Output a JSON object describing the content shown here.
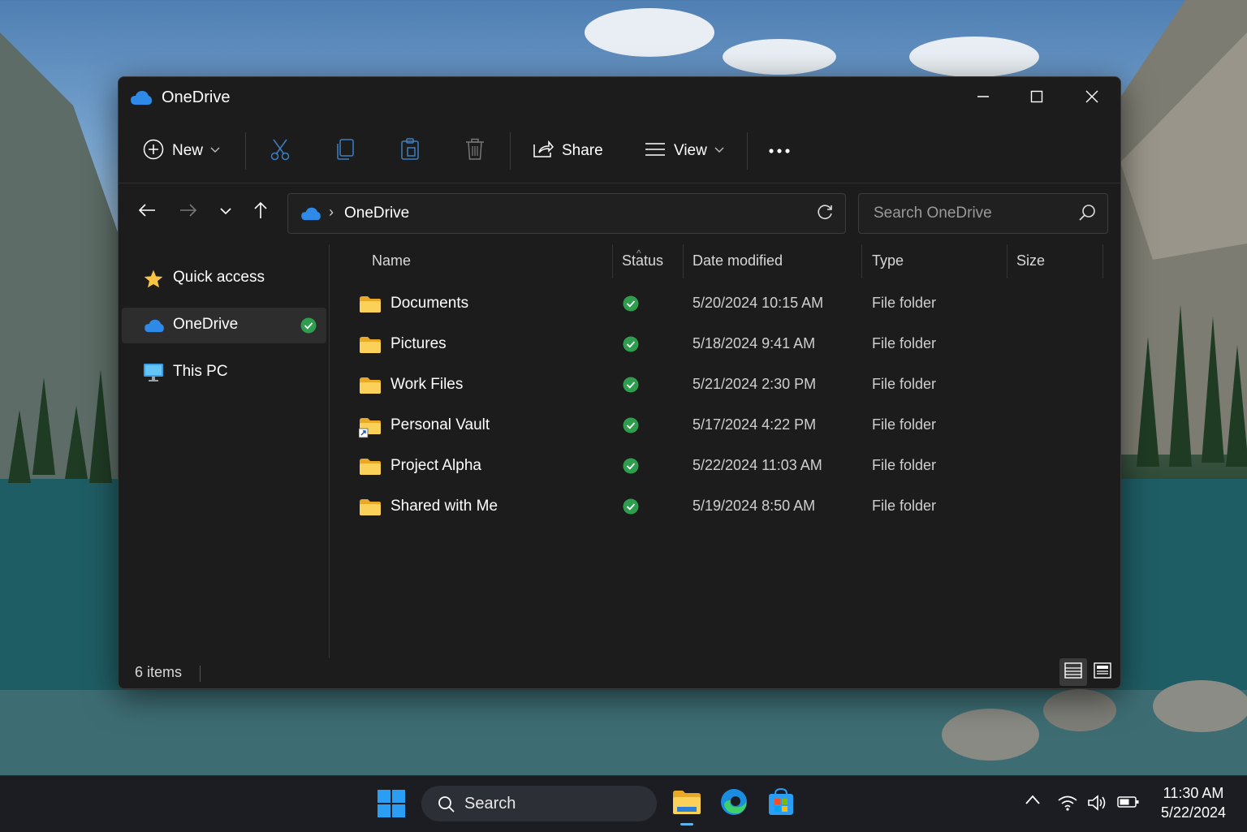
{
  "window": {
    "title": "OneDrive",
    "controls": [
      "minimize",
      "maximize",
      "close"
    ]
  },
  "toolbar": {
    "new_label": "New",
    "share_label": "Share",
    "view_label": "View",
    "icons": [
      "plus-circle-icon",
      "cut-icon",
      "copy-icon",
      "paste-icon",
      "delete-icon",
      "share-icon",
      "view-icon",
      "more-icon"
    ]
  },
  "nav": {
    "address": "OneDrive",
    "search_placeholder": "Search OneDrive"
  },
  "sidebar": {
    "items": [
      {
        "label": "Quick access",
        "icon": "star-icon",
        "selected": false
      },
      {
        "label": "OneDrive",
        "icon": "cloud-icon",
        "selected": true,
        "status": "synced"
      },
      {
        "label": "This PC",
        "icon": "monitor-icon",
        "selected": false
      }
    ]
  },
  "columns": {
    "name": "Name",
    "status": "Status",
    "date": "Date modified",
    "type": "Type",
    "size": "Size"
  },
  "files": [
    {
      "name": "Documents",
      "status": "synced",
      "date": "5/20/2024 10:15 AM",
      "type": "File folder"
    },
    {
      "name": "Pictures",
      "status": "synced",
      "date": "5/18/2024 9:41 AM",
      "type": "File folder"
    },
    {
      "name": "Work Files",
      "status": "synced",
      "date": "5/21/2024 2:30 PM",
      "type": "File folder"
    },
    {
      "name": "Personal Vault",
      "status": "synced",
      "date": "5/17/2024 4:22 PM",
      "type": "File folder",
      "shortcut": true
    },
    {
      "name": "Project Alpha",
      "status": "synced",
      "date": "5/22/2024 11:03 AM",
      "type": "File folder"
    },
    {
      "name": "Shared with Me",
      "status": "synced",
      "date": "5/19/2024 8:50 AM",
      "type": "File folder"
    }
  ],
  "statusbar": {
    "count": "6 items"
  },
  "taskbar": {
    "search_label": "Search",
    "apps": [
      "file-explorer-icon",
      "edge-icon",
      "store-icon"
    ],
    "time": "11:30 AM",
    "date": "5/22/2024"
  },
  "colors": {
    "window_bg": "#1c1c1c",
    "accent": "#0f6cbd",
    "folder": "#f4c542",
    "sync_ok": "#2e9e4e",
    "taskbar_bg": "#1b1d22"
  }
}
